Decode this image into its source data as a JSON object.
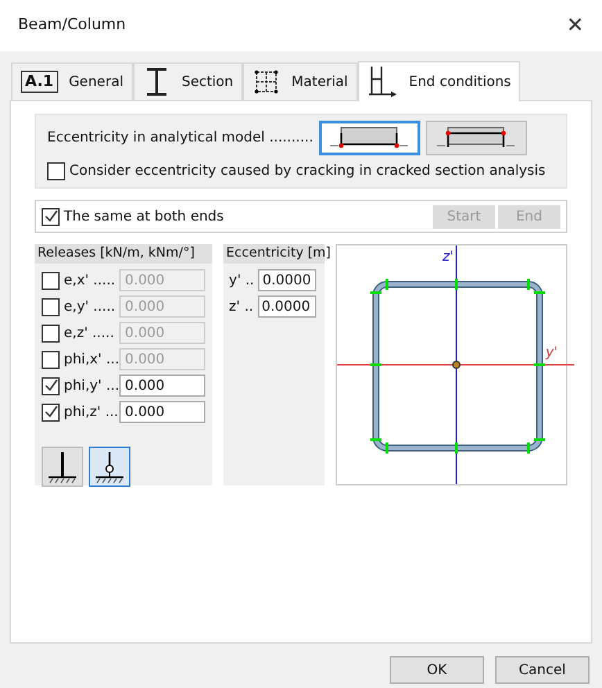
{
  "window": {
    "title": "Beam/Column",
    "close": "✕"
  },
  "tabs": [
    {
      "kind": "general",
      "badge": "A.1",
      "label": "General",
      "selected": false
    },
    {
      "kind": "section",
      "label": "Section",
      "selected": false
    },
    {
      "kind": "material",
      "label": "Material",
      "selected": false
    },
    {
      "kind": "end",
      "label": "End conditions",
      "selected": true
    }
  ],
  "eccentricity_model": {
    "label": "Eccentricity in analytical model ..........",
    "options": [
      {
        "kind": "bottom",
        "selected": true
      },
      {
        "kind": "top",
        "selected": false
      }
    ],
    "cracking": {
      "label": "Consider eccentricity caused by cracking in cracked section analysis",
      "checked": false
    }
  },
  "same_at_both_ends": {
    "label": "The same at both ends",
    "checked": true
  },
  "end_buttons": [
    {
      "label": "Start",
      "disabled": true
    },
    {
      "label": "End",
      "disabled": true
    }
  ],
  "releases": {
    "title": "Releases [kN/m, kNm/°]",
    "rows": [
      {
        "label": "e,x' .....",
        "checked": false,
        "value": "0.000"
      },
      {
        "label": "e,y' .....",
        "checked": false,
        "value": "0.000"
      },
      {
        "label": "e,z' .....",
        "checked": false,
        "value": "0.000"
      },
      {
        "label": "phi,x' ...",
        "checked": false,
        "value": "0.000"
      },
      {
        "label": "phi,y' ...",
        "checked": true,
        "value": "0.000"
      },
      {
        "label": "phi,z' ...",
        "checked": true,
        "value": "0.000"
      }
    ],
    "supports": [
      {
        "kind": "fixed",
        "selected": false
      },
      {
        "kind": "hinged",
        "selected": true
      }
    ]
  },
  "eccentricity": {
    "title": "Eccentricity [m]",
    "rows": [
      {
        "label": "y' ..",
        "value": "0.0000"
      },
      {
        "label": "z' ..",
        "value": "0.0000"
      }
    ]
  },
  "section_view": {
    "z_axis": "z'",
    "y_axis": "y'"
  },
  "buttons": [
    "OK",
    "Cancel"
  ]
}
